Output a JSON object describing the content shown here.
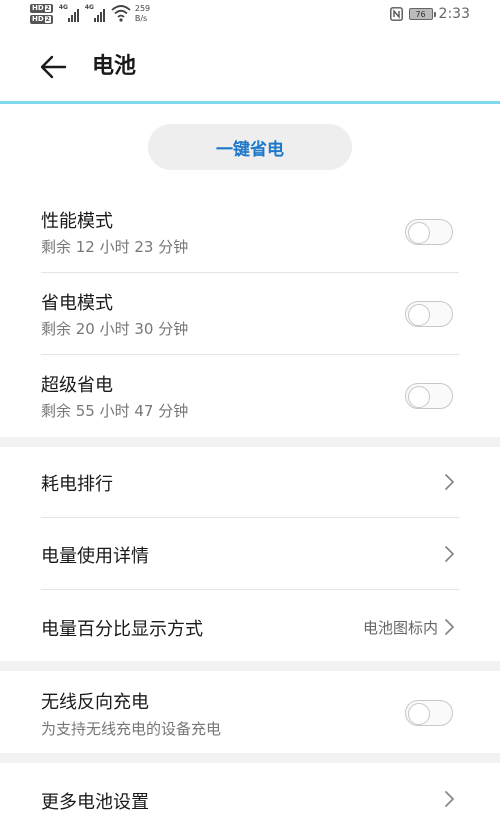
{
  "status_bar": {
    "hd_label": "HD",
    "hd_sub": "2",
    "signal_label_1": "4G",
    "signal_label_2": "4G",
    "net_speed_value": "259",
    "net_speed_unit": "B/s",
    "battery_level": "76",
    "time": "2:33"
  },
  "app_bar": {
    "title": "电池",
    "back_icon": "back-arrow-icon"
  },
  "one_key": {
    "label": "一键省电",
    "color": "#1f78c8"
  },
  "modes": [
    {
      "title": "性能模式",
      "remaining": "剩余 12 小时 23 分钟",
      "enabled": false
    },
    {
      "title": "省电模式",
      "remaining": "剩余 20 小时 30 分钟",
      "enabled": false
    },
    {
      "title": "超级省电",
      "remaining": "剩余 55 小时 47 分钟",
      "enabled": false
    }
  ],
  "menu": [
    {
      "label": "耗电排行",
      "value": ""
    },
    {
      "label": "电量使用详情",
      "value": ""
    },
    {
      "label": "电量百分比显示方式",
      "value": "电池图标内"
    }
  ],
  "wireless": {
    "title": "无线反向充电",
    "subtitle": "为支持无线充电的设备充电",
    "enabled": false
  },
  "more": {
    "label": "更多电池设置"
  }
}
